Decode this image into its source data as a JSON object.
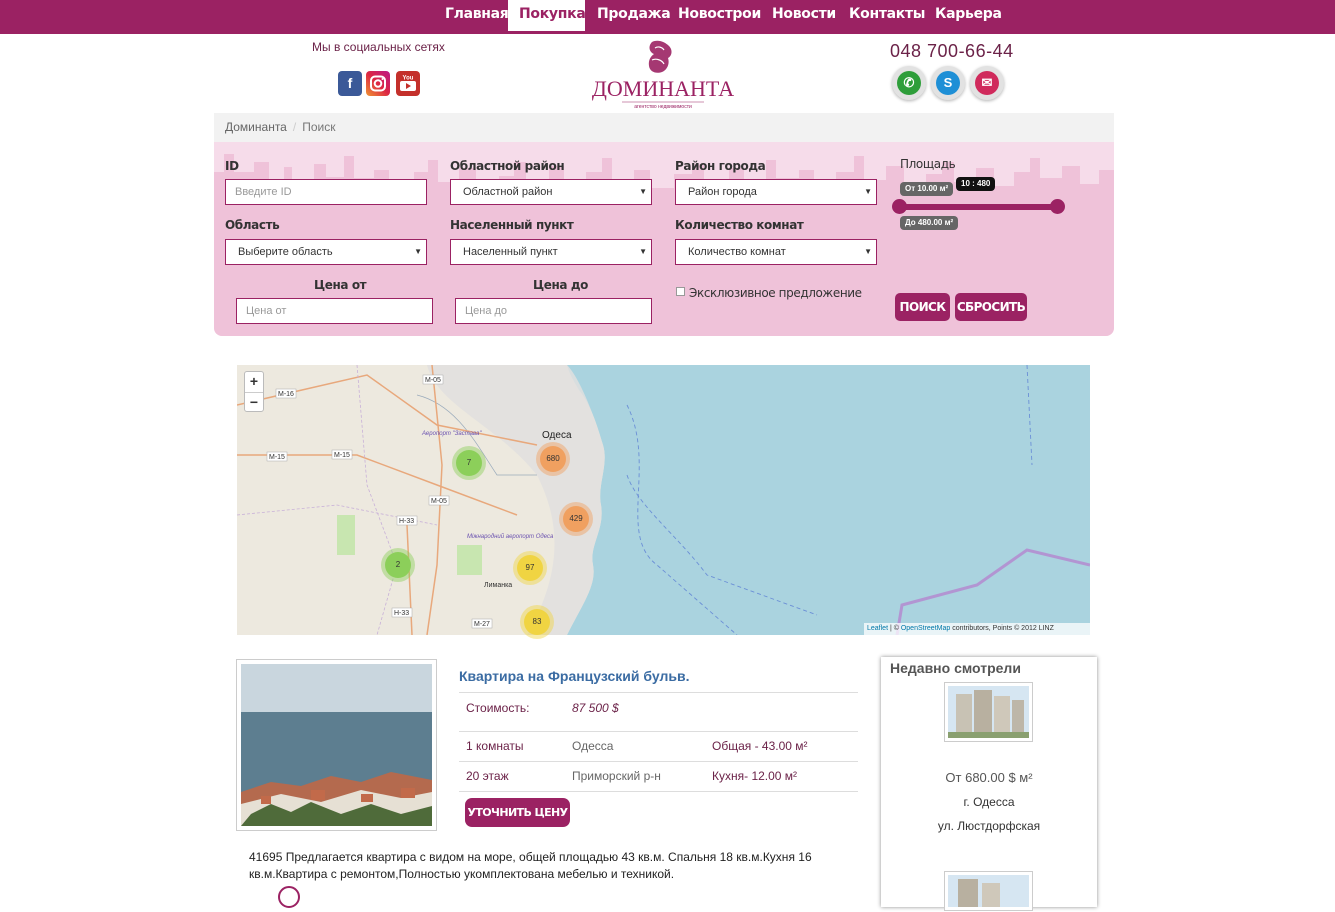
{
  "nav": {
    "items": [
      "Главная",
      "Покупка",
      "Продажа",
      "Новострои",
      "Новости",
      "Контакты",
      "Карьера"
    ],
    "active": "Покупка"
  },
  "header": {
    "social_title": "Мы в социальных сетях",
    "social_icons": [
      "facebook-icon",
      "instagram-icon",
      "youtube-icon"
    ],
    "logo_text": "ДОМИНАНТА",
    "logo_subtitle": "агентство недвижимости",
    "phone": "048 700-66-44",
    "contact_icons": [
      "phone-icon",
      "skype-icon",
      "email-icon"
    ],
    "brand_color": "#9b2263"
  },
  "breadcrumb": [
    "Доминанта",
    "Поиск"
  ],
  "search": {
    "id_label": "ID",
    "id_placeholder": "Введите ID",
    "region_district_label": "Областной район",
    "region_district_value": "Областной район",
    "city_district_label": "Район города",
    "city_district_value": "Район города",
    "area_label": "Площадь",
    "oblast_label": "Область",
    "oblast_value": "Выберите область",
    "settlement_label": "Населенный пункт",
    "settlement_value": "Населенный пункт",
    "rooms_label": "Количество комнат",
    "rooms_value": "Количество комнат",
    "price_from_label": "Цена от",
    "price_from_placeholder": "Цена от",
    "price_to_label": "Цена до",
    "price_to_placeholder": "Цена до",
    "exclusive_label": "Эксклюзивное предложение",
    "exclusive_checked": false,
    "search_button": "ПОИСК",
    "reset_button": "СБРОСИТЬ",
    "slider_tooltip": "10 : 480",
    "area_from": "От 10.00 м²",
    "area_to": "До 480.00 м²",
    "area_min": 10,
    "area_max": 480
  },
  "map": {
    "zoom_in": "+",
    "zoom_out": "−",
    "clusters": [
      "7",
      "680",
      "429",
      "2",
      "97",
      "83"
    ],
    "city_label": "Одеса",
    "place_labels": [
      "Аеропорт \"Застава\"",
      "Міжнародний аеропорт Одеса",
      "Лиманка"
    ],
    "road_labels": [
      "М-05",
      "М-16",
      "М-15",
      "М-15",
      "М-05",
      "Н-33",
      "Н-33",
      "М-27"
    ],
    "attribution_leaflet": "Leaflet",
    "attribution_osm": "OpenStreetMap",
    "attribution_rest": "contributors, Points © 2012 LINZ"
  },
  "listing": {
    "title": "Квартира на Французский бульв.",
    "price_label": "Стоимость:",
    "price_value": "87 500 $",
    "rooms": "1 комнаты",
    "city": "Одесса",
    "total_area": "Общая - 43.00 м²",
    "floor": "20 этаж",
    "district": "Приморский р-н",
    "kitchen_area": "Кухня- 12.00 м²",
    "clarify_button": "УТОЧНИТЬ ЦЕНУ",
    "description": "41695 Предлагается квартира с видом на море, общей площадью 43 кв.м. Спальня 18 кв.м.Кухня 16 кв.м.Квартира с ремонтом,Полностью укомплектована мебелью и техникой."
  },
  "recent": {
    "title": "Недавно смотрели",
    "items": [
      {
        "price": "От 680.00 $ м²",
        "city": "г. Одесса",
        "street": "ул. Люстдорфская"
      }
    ]
  }
}
